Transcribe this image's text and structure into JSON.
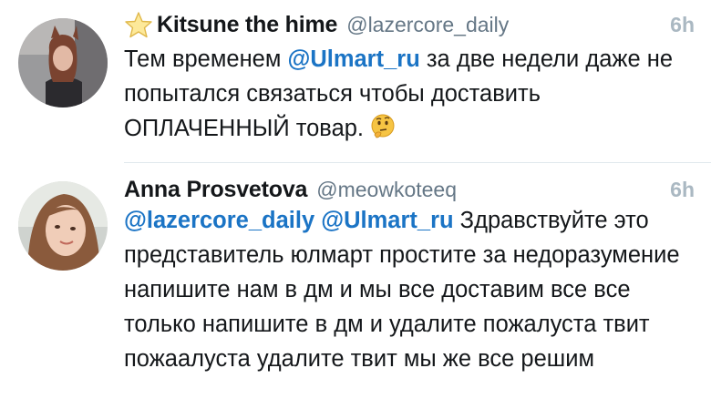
{
  "tweets": [
    {
      "display_name": "Kitsune the hime",
      "handle": "@lazercore_daily",
      "time": "6h",
      "mention": "@Ulmart_ru",
      "text_before": "Тем временем ",
      "text_after": " за две недели даже не попытался связаться чтобы доставить ОПЛАЧЕННЫЙ товар.",
      "badge_icon": "star-icon",
      "trailing_emoji": "thinking-face-emoji"
    },
    {
      "display_name": "Anna Prosvetova",
      "handle": "@meowkoteeq",
      "time": "6h",
      "mention_1": "@lazercore_daily",
      "mention_2": "@Ulmart_ru",
      "text_after": " Здравствуйте это представитель юлмарт простите за недоразумение напишите нам в дм и мы все доставим все все только напишите в дм и удалите пожалуста твит пожаалуста удалите твит мы же все решим"
    }
  ],
  "colors": {
    "mention": "#1b74c5",
    "secondary": "#657786",
    "time": "#aab8c2",
    "divider": "#e1e8ed"
  }
}
